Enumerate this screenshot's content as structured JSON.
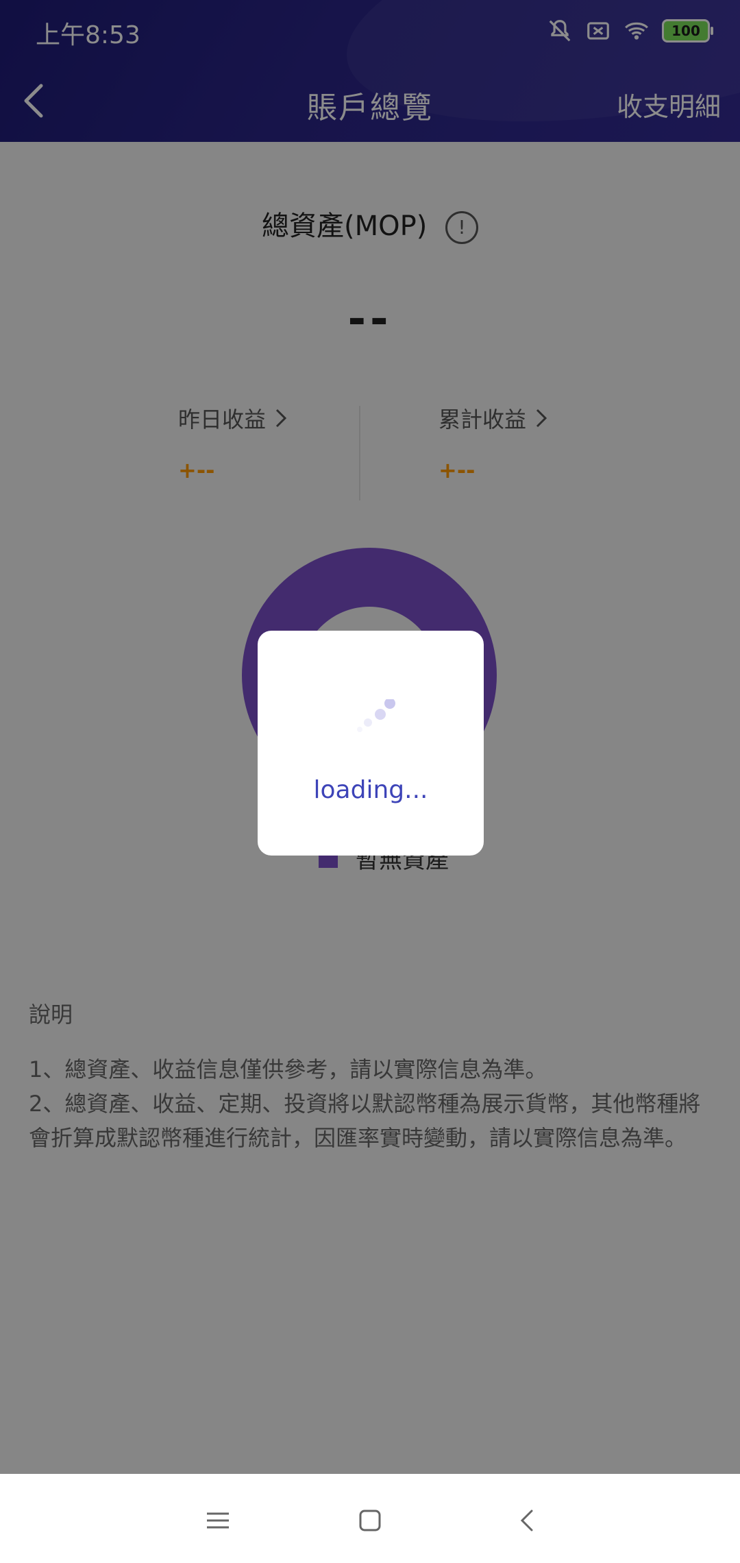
{
  "status": {
    "time": "上午8:53",
    "battery": "100"
  },
  "nav": {
    "title": "賬戶總覽",
    "right_action": "收支明細"
  },
  "summary": {
    "total_label": "總資產(MOP)",
    "total_value": "--"
  },
  "earnings": {
    "yesterday": {
      "label": "昨日收益",
      "value": "+--"
    },
    "cumulative": {
      "label": "累計收益",
      "value": "+--"
    }
  },
  "chart_data": {
    "type": "pie",
    "categories": [
      "暫無資產"
    ],
    "values": [
      100
    ],
    "colors": [
      "#7b4fc8"
    ],
    "legend": "bottom"
  },
  "legend": {
    "label": "暫無資產"
  },
  "explanation": {
    "title": "說明",
    "line1": "1、總資產、收益信息僅供參考，請以實際信息為準。",
    "line2": "2、總資產、收益、定期、投資將以默認幣種為展示貨幣，其他幣種將會折算成默認幣種進行統計，因匯率實時變動，請以實際信息為準。"
  },
  "loading": {
    "text": "loading..."
  },
  "icons": {
    "back": "chevron-left-icon",
    "info": "info-icon",
    "nav_menu": "menu-icon",
    "nav_home": "home-icon",
    "nav_back": "back-icon"
  }
}
